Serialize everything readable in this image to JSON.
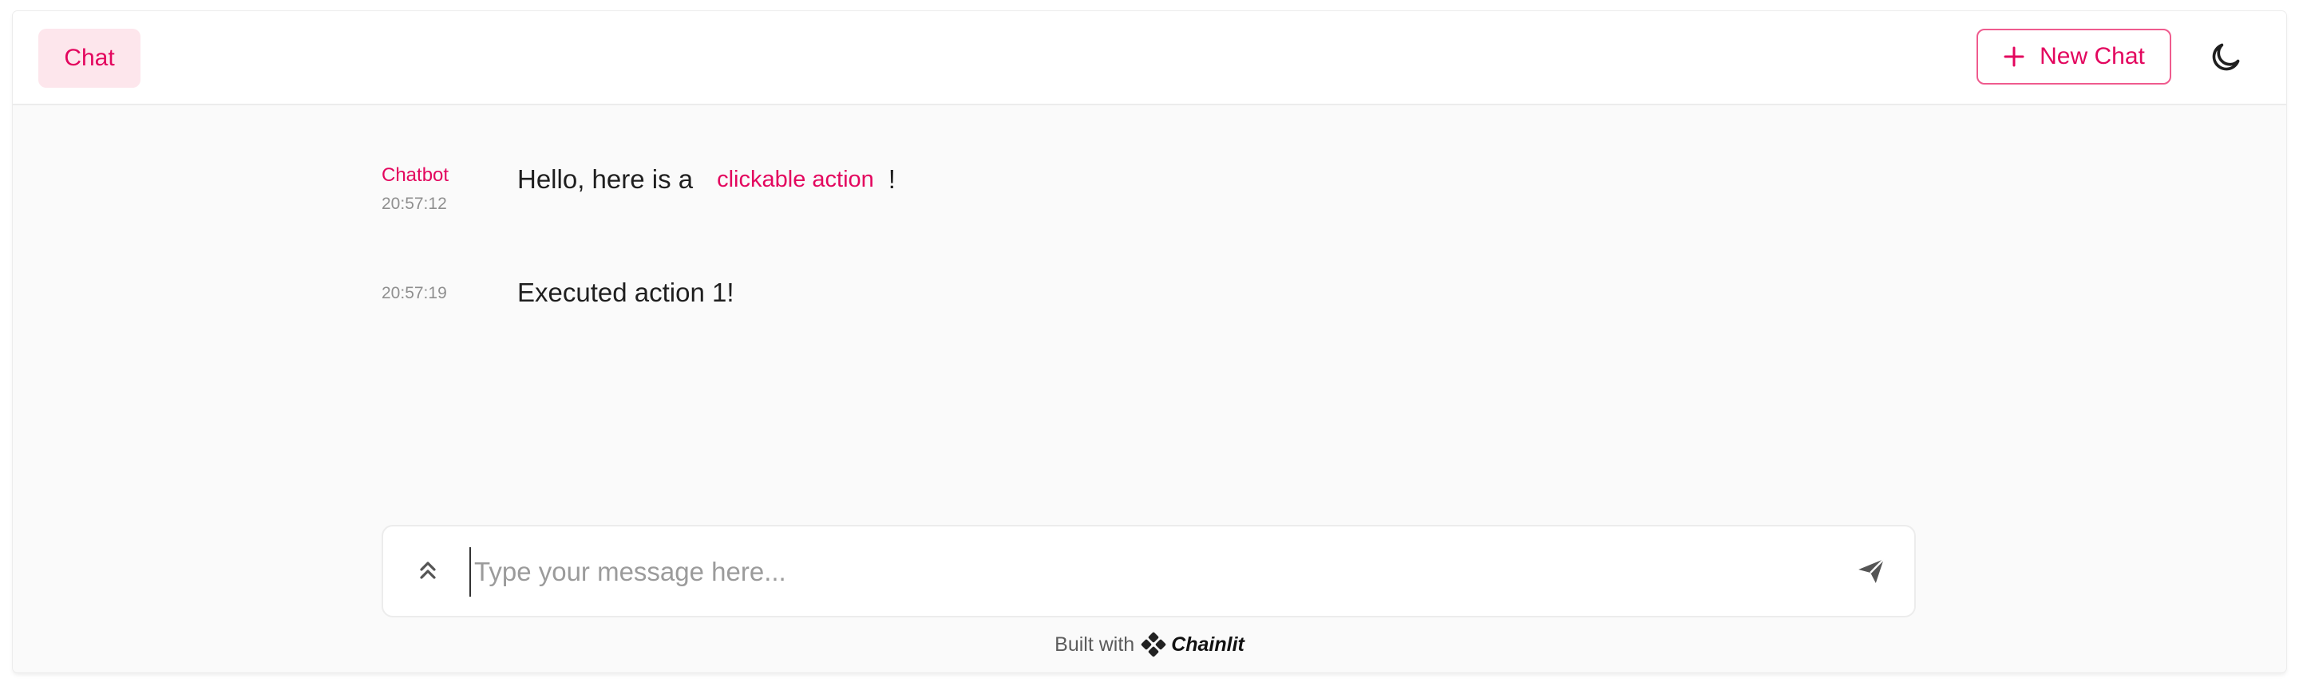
{
  "header": {
    "chat_tab_label": "Chat",
    "new_chat_label": "New Chat"
  },
  "messages": [
    {
      "author": "Chatbot",
      "timestamp": "20:57:12",
      "text_before": "Hello, here is a",
      "action_label": "clickable action",
      "text_after": "!"
    },
    {
      "author": "",
      "timestamp": "20:57:19",
      "text": "Executed action 1!"
    }
  ],
  "composer": {
    "placeholder": "Type your message here...",
    "value": ""
  },
  "footer": {
    "built_with": "Built with",
    "brand": "Chainlit"
  },
  "colors": {
    "accent": "#e3065e",
    "accent_light": "#fde6ec",
    "background": "#fafafa"
  },
  "icons": {
    "new_chat": "plus-icon",
    "theme": "moon-icon",
    "settings": "chevrons-up-icon",
    "send": "send-icon",
    "logo": "chainlit-logo-icon"
  }
}
